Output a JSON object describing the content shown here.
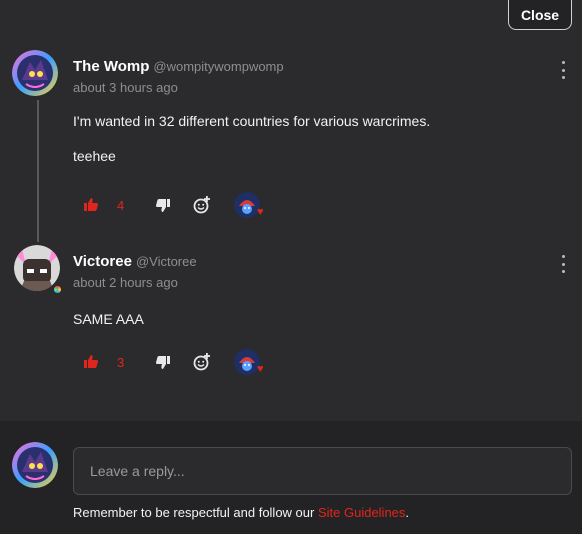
{
  "header": {
    "close_label": "Close"
  },
  "comments": [
    {
      "author": "The Womp",
      "handle": "@wompitywompwomp",
      "time": "about 3 hours ago",
      "paragraphs": [
        "I'm wanted in 32 different countries for various warcrimes.",
        "teehee"
      ],
      "like_count": "4",
      "icons": [
        "thumbs-up-icon",
        "thumbs-down-icon",
        "add-reaction-icon",
        "kebab-menu-icon"
      ],
      "reaction": "heart"
    },
    {
      "author": "Victoree",
      "handle": "@Victoree",
      "time": "about 2 hours ago",
      "paragraphs": [
        "SAME AAA"
      ],
      "like_count": "3",
      "icons": [
        "thumbs-up-icon",
        "thumbs-down-icon",
        "add-reaction-icon",
        "kebab-menu-icon"
      ],
      "reaction": "heart"
    }
  ],
  "reply": {
    "placeholder": "Leave a reply...",
    "guidelines_prefix": "Remember to be respectful and follow our ",
    "guidelines_link": "Site Guidelines",
    "guidelines_suffix": "."
  },
  "colors": {
    "accent": "#e0261c",
    "background": "#2b2b2d",
    "footer": "#232325",
    "muted": "#8e8e92"
  }
}
